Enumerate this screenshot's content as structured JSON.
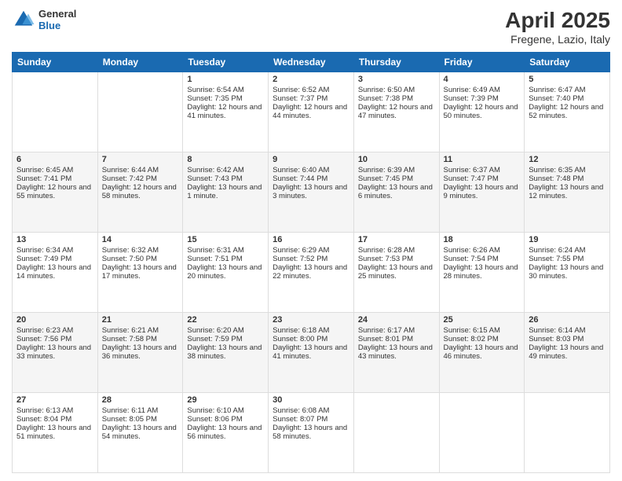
{
  "header": {
    "logo_general": "General",
    "logo_blue": "Blue",
    "title": "April 2025",
    "subtitle": "Fregene, Lazio, Italy"
  },
  "days_of_week": [
    "Sunday",
    "Monday",
    "Tuesday",
    "Wednesday",
    "Thursday",
    "Friday",
    "Saturday"
  ],
  "weeks": [
    [
      {
        "day": "",
        "info": ""
      },
      {
        "day": "",
        "info": ""
      },
      {
        "day": "1",
        "info": "Sunrise: 6:54 AM\nSunset: 7:35 PM\nDaylight: 12 hours and 41 minutes."
      },
      {
        "day": "2",
        "info": "Sunrise: 6:52 AM\nSunset: 7:37 PM\nDaylight: 12 hours and 44 minutes."
      },
      {
        "day": "3",
        "info": "Sunrise: 6:50 AM\nSunset: 7:38 PM\nDaylight: 12 hours and 47 minutes."
      },
      {
        "day": "4",
        "info": "Sunrise: 6:49 AM\nSunset: 7:39 PM\nDaylight: 12 hours and 50 minutes."
      },
      {
        "day": "5",
        "info": "Sunrise: 6:47 AM\nSunset: 7:40 PM\nDaylight: 12 hours and 52 minutes."
      }
    ],
    [
      {
        "day": "6",
        "info": "Sunrise: 6:45 AM\nSunset: 7:41 PM\nDaylight: 12 hours and 55 minutes."
      },
      {
        "day": "7",
        "info": "Sunrise: 6:44 AM\nSunset: 7:42 PM\nDaylight: 12 hours and 58 minutes."
      },
      {
        "day": "8",
        "info": "Sunrise: 6:42 AM\nSunset: 7:43 PM\nDaylight: 13 hours and 1 minute."
      },
      {
        "day": "9",
        "info": "Sunrise: 6:40 AM\nSunset: 7:44 PM\nDaylight: 13 hours and 3 minutes."
      },
      {
        "day": "10",
        "info": "Sunrise: 6:39 AM\nSunset: 7:45 PM\nDaylight: 13 hours and 6 minutes."
      },
      {
        "day": "11",
        "info": "Sunrise: 6:37 AM\nSunset: 7:47 PM\nDaylight: 13 hours and 9 minutes."
      },
      {
        "day": "12",
        "info": "Sunrise: 6:35 AM\nSunset: 7:48 PM\nDaylight: 13 hours and 12 minutes."
      }
    ],
    [
      {
        "day": "13",
        "info": "Sunrise: 6:34 AM\nSunset: 7:49 PM\nDaylight: 13 hours and 14 minutes."
      },
      {
        "day": "14",
        "info": "Sunrise: 6:32 AM\nSunset: 7:50 PM\nDaylight: 13 hours and 17 minutes."
      },
      {
        "day": "15",
        "info": "Sunrise: 6:31 AM\nSunset: 7:51 PM\nDaylight: 13 hours and 20 minutes."
      },
      {
        "day": "16",
        "info": "Sunrise: 6:29 AM\nSunset: 7:52 PM\nDaylight: 13 hours and 22 minutes."
      },
      {
        "day": "17",
        "info": "Sunrise: 6:28 AM\nSunset: 7:53 PM\nDaylight: 13 hours and 25 minutes."
      },
      {
        "day": "18",
        "info": "Sunrise: 6:26 AM\nSunset: 7:54 PM\nDaylight: 13 hours and 28 minutes."
      },
      {
        "day": "19",
        "info": "Sunrise: 6:24 AM\nSunset: 7:55 PM\nDaylight: 13 hours and 30 minutes."
      }
    ],
    [
      {
        "day": "20",
        "info": "Sunrise: 6:23 AM\nSunset: 7:56 PM\nDaylight: 13 hours and 33 minutes."
      },
      {
        "day": "21",
        "info": "Sunrise: 6:21 AM\nSunset: 7:58 PM\nDaylight: 13 hours and 36 minutes."
      },
      {
        "day": "22",
        "info": "Sunrise: 6:20 AM\nSunset: 7:59 PM\nDaylight: 13 hours and 38 minutes."
      },
      {
        "day": "23",
        "info": "Sunrise: 6:18 AM\nSunset: 8:00 PM\nDaylight: 13 hours and 41 minutes."
      },
      {
        "day": "24",
        "info": "Sunrise: 6:17 AM\nSunset: 8:01 PM\nDaylight: 13 hours and 43 minutes."
      },
      {
        "day": "25",
        "info": "Sunrise: 6:15 AM\nSunset: 8:02 PM\nDaylight: 13 hours and 46 minutes."
      },
      {
        "day": "26",
        "info": "Sunrise: 6:14 AM\nSunset: 8:03 PM\nDaylight: 13 hours and 49 minutes."
      }
    ],
    [
      {
        "day": "27",
        "info": "Sunrise: 6:13 AM\nSunset: 8:04 PM\nDaylight: 13 hours and 51 minutes."
      },
      {
        "day": "28",
        "info": "Sunrise: 6:11 AM\nSunset: 8:05 PM\nDaylight: 13 hours and 54 minutes."
      },
      {
        "day": "29",
        "info": "Sunrise: 6:10 AM\nSunset: 8:06 PM\nDaylight: 13 hours and 56 minutes."
      },
      {
        "day": "30",
        "info": "Sunrise: 6:08 AM\nSunset: 8:07 PM\nDaylight: 13 hours and 58 minutes."
      },
      {
        "day": "",
        "info": ""
      },
      {
        "day": "",
        "info": ""
      },
      {
        "day": "",
        "info": ""
      }
    ]
  ]
}
